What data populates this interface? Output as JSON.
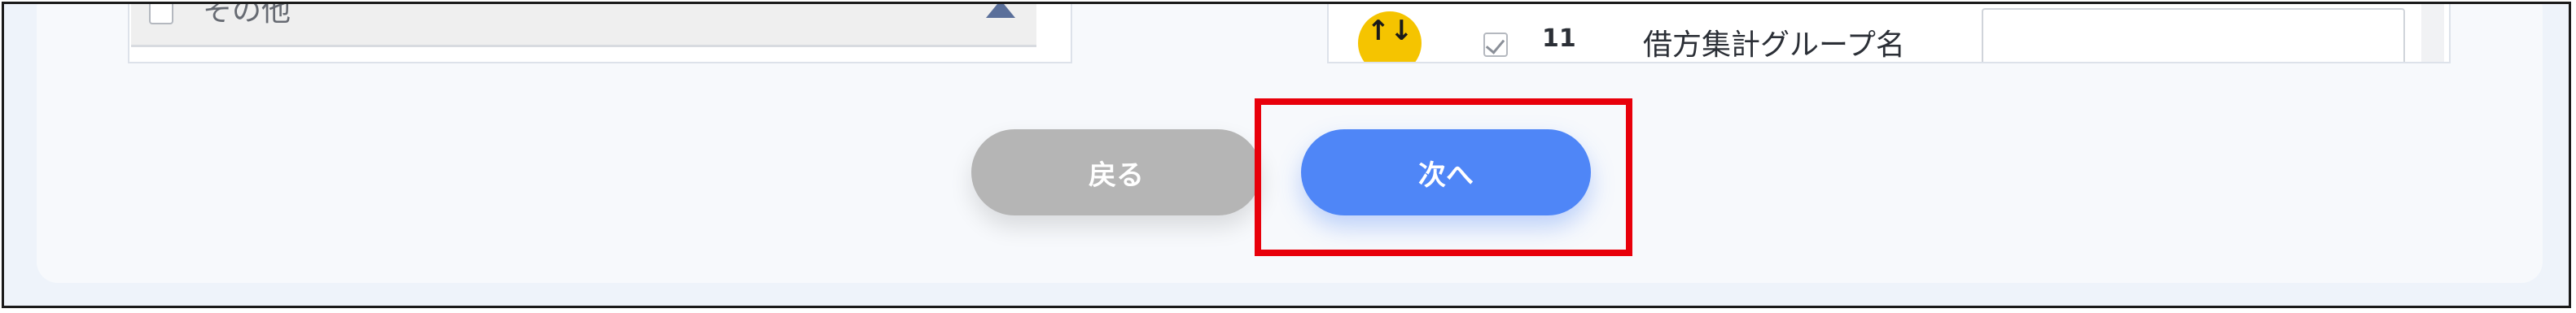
{
  "left_list": {
    "item_label": "その他"
  },
  "right_list": {
    "sort_icon": "↑↓",
    "row_number": "11",
    "group_name": "借方集計グループ名",
    "checked": true
  },
  "footer": {
    "back_label": "戻る",
    "next_label": "次へ"
  },
  "colors": {
    "next_button": "#4f86f7",
    "back_button": "#b5b5b5",
    "highlight": "#e8000b",
    "sort_badge": "#f5c400"
  }
}
